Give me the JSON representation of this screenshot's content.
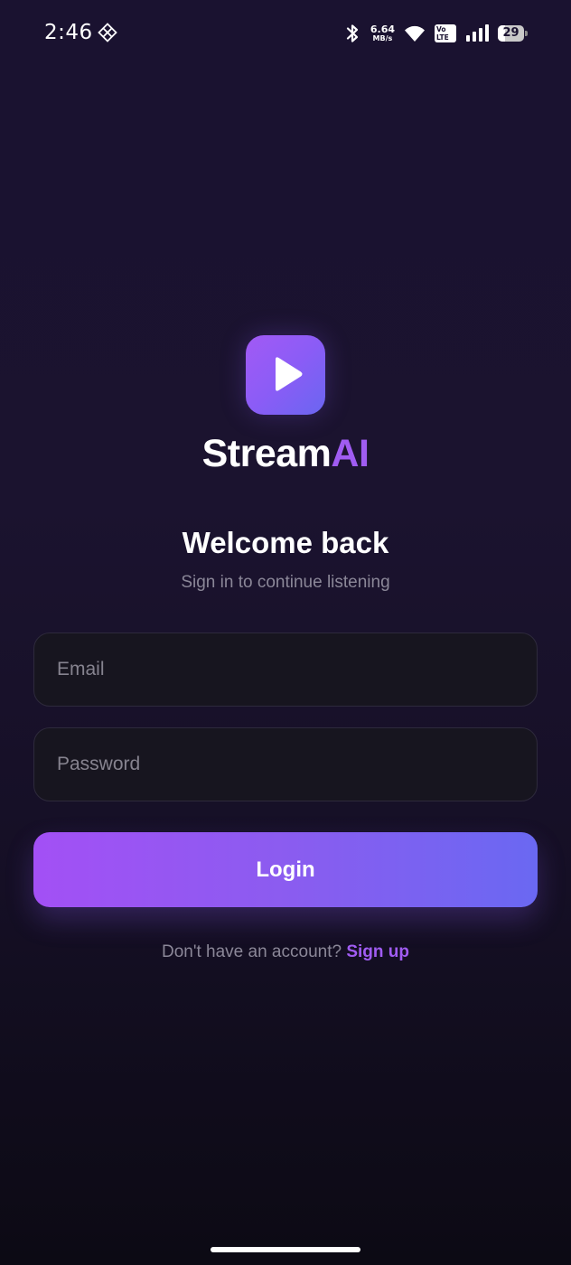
{
  "status_bar": {
    "time": "2:46",
    "network_speed_value": "6.64",
    "network_speed_unit": "MB/s",
    "volte_label_top": "Vo",
    "volte_label_bottom": "LTE",
    "battery_level": "29",
    "icons": [
      "grid-diamond-icon",
      "bluetooth-icon",
      "wifi-icon",
      "volte-icon",
      "signal-icon",
      "battery-icon"
    ]
  },
  "brand": {
    "name_main": "Stream",
    "name_accent": "AI",
    "logo_icon": "play-icon",
    "accent_color": "#a05cf2"
  },
  "heading": {
    "title": "Welcome back",
    "subtitle": "Sign in to continue listening"
  },
  "form": {
    "email_placeholder": "Email",
    "email_value": "",
    "password_placeholder": "Password",
    "password_value": "",
    "login_label": "Login"
  },
  "footer": {
    "prompt": "Don't have an account?",
    "signup_label": "Sign up"
  },
  "colors": {
    "background_top": "#1a1230",
    "background_bottom": "#0c0a14",
    "gradient_start": "#a350f5",
    "gradient_end": "#6a68f2",
    "field_background": "#17151f",
    "muted_text": "#8b8798"
  }
}
